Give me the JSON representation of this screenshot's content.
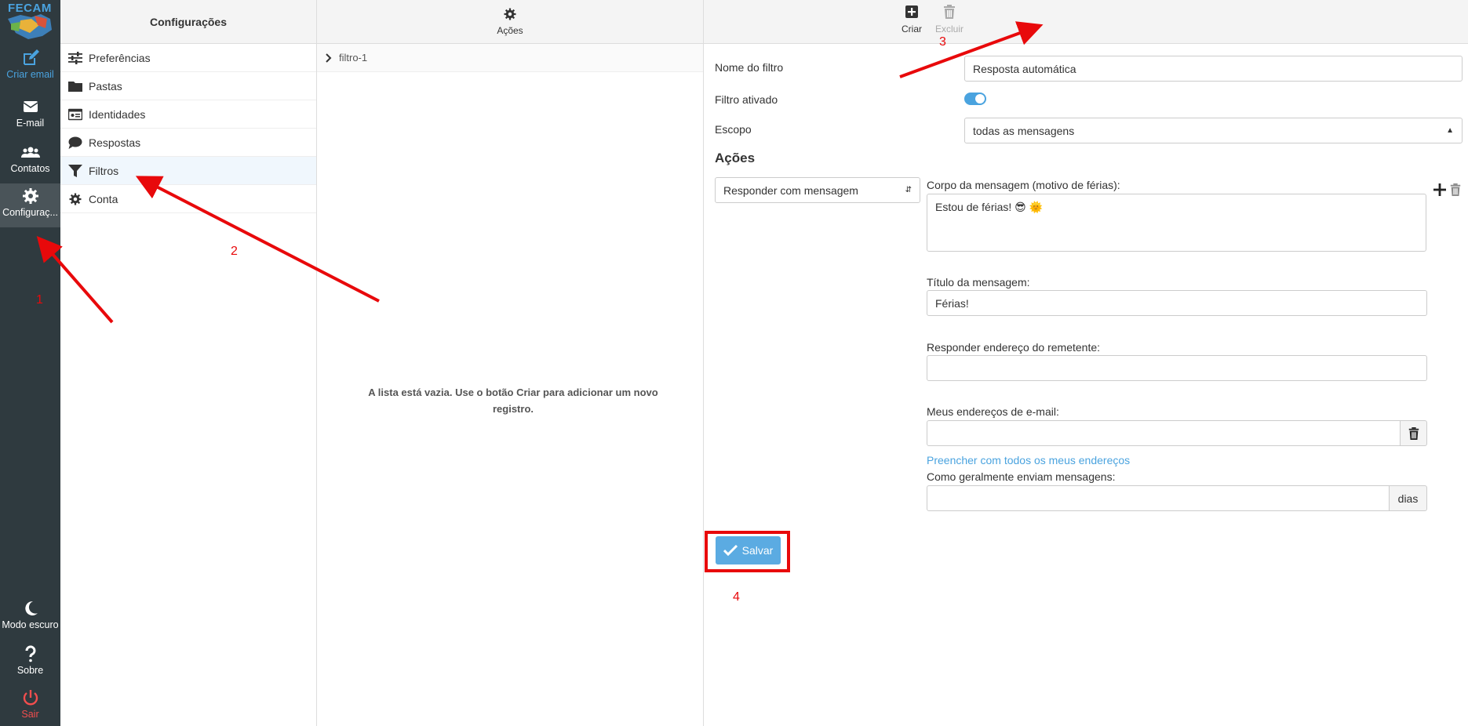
{
  "nav": {
    "logo": "FECAM",
    "items": [
      {
        "label": "Criar email",
        "icon": "compose-icon"
      },
      {
        "label": "E-mail",
        "icon": "envelope-icon"
      },
      {
        "label": "Contatos",
        "icon": "users-icon"
      },
      {
        "label": "Configuraç...",
        "icon": "gear-icon"
      },
      {
        "label": "Modo escuro",
        "icon": "moon-icon"
      },
      {
        "label": "Sobre",
        "icon": "question-icon"
      },
      {
        "label": "Sair",
        "icon": "power-icon"
      }
    ]
  },
  "settings": {
    "title": "Configurações",
    "items": [
      {
        "label": "Preferências",
        "icon": "sliders-icon"
      },
      {
        "label": "Pastas",
        "icon": "folder-icon"
      },
      {
        "label": "Identidades",
        "icon": "id-card-icon"
      },
      {
        "label": "Respostas",
        "icon": "comment-icon"
      },
      {
        "label": "Filtros",
        "icon": "filter-icon"
      },
      {
        "label": "Conta",
        "icon": "gear-icon"
      }
    ]
  },
  "filters": {
    "header_label": "Ações",
    "rows": [
      {
        "label": "filtro-1"
      }
    ],
    "empty_message": "A lista está vazia. Use o botão Criar para adicionar um novo registro."
  },
  "toolbar": {
    "create_label": "Criar",
    "delete_label": "Excluir"
  },
  "form": {
    "filter_name_label": "Nome do filtro",
    "filter_name_value": "Resposta automática",
    "enabled_label": "Filtro ativado",
    "enabled": true,
    "scope_label": "Escopo",
    "scope_value": "todas as mensagens",
    "actions_title": "Ações",
    "action_select": "Responder com mensagem",
    "body_label": "Corpo da mensagem (motivo de férias):",
    "body_value": "Estou de férias! 😎 🌞",
    "subject_label": "Título da mensagem:",
    "subject_value": "Férias!",
    "reply_sender_label": "Responder endereço do remetente:",
    "reply_sender_value": "",
    "my_addresses_label": "Meus endereços de e-mail:",
    "my_addresses_value": "",
    "fill_addresses_link": "Preencher com todos os meus endereços",
    "how_often_label": "Como geralmente enviam mensagens:",
    "how_often_value": "",
    "days_addon": "dias",
    "save_label": "Salvar"
  },
  "annotations": [
    "1",
    "2",
    "3",
    "4"
  ],
  "colors": {
    "nav_bg": "#2f3a3f",
    "accent": "#4aa3df",
    "annotation": "#e8090b"
  }
}
